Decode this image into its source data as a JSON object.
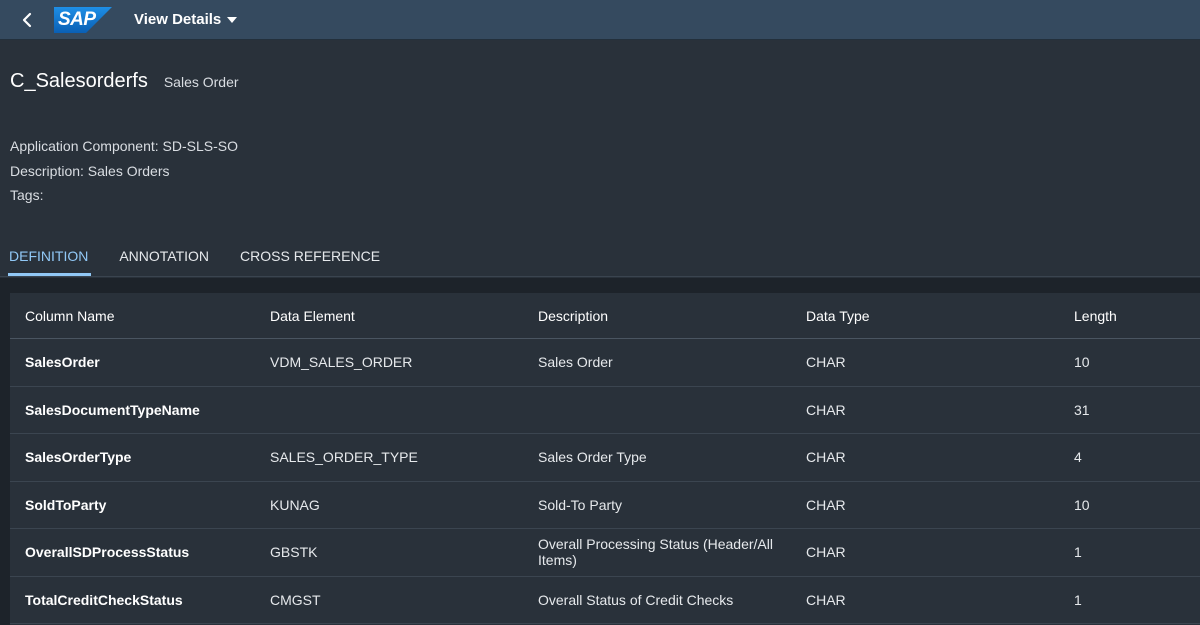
{
  "shell": {
    "logo_text": "SAP",
    "menu_title": "View Details"
  },
  "header": {
    "title": "C_Salesorderfs",
    "subtitle": "Sales Order",
    "application_component": "Application Component: SD-SLS-SO",
    "description": "Description: Sales Orders",
    "tags": "Tags:"
  },
  "tabs": [
    {
      "label": "DEFINITION",
      "selected": true
    },
    {
      "label": "ANNOTATION",
      "selected": false
    },
    {
      "label": "CROSS REFERENCE",
      "selected": false
    }
  ],
  "table": {
    "columns": [
      "Column Name",
      "Data Element",
      "Description",
      "Data Type",
      "Length"
    ],
    "rows": [
      [
        "SalesOrder",
        "VDM_SALES_ORDER",
        "Sales Order",
        "CHAR",
        "10"
      ],
      [
        "SalesDocumentTypeName",
        "",
        "",
        "CHAR",
        "31"
      ],
      [
        "SalesOrderType",
        "SALES_ORDER_TYPE",
        "Sales Order Type",
        "CHAR",
        "4"
      ],
      [
        "SoldToParty",
        "KUNAG",
        "Sold-To Party",
        "CHAR",
        "10"
      ],
      [
        "OverallSDProcessStatus",
        "GBSTK",
        "Overall Processing Status (Header/All Items)",
        "CHAR",
        "1"
      ],
      [
        "TotalCreditCheckStatus",
        "CMGST",
        "Overall Status of Credit Checks",
        "CHAR",
        "1"
      ]
    ]
  },
  "colors": {
    "shell_bg": "#354a5f",
    "page_bg": "#29313a",
    "accent": "#91c8f6",
    "logo_bg": "#0a6ed1"
  }
}
